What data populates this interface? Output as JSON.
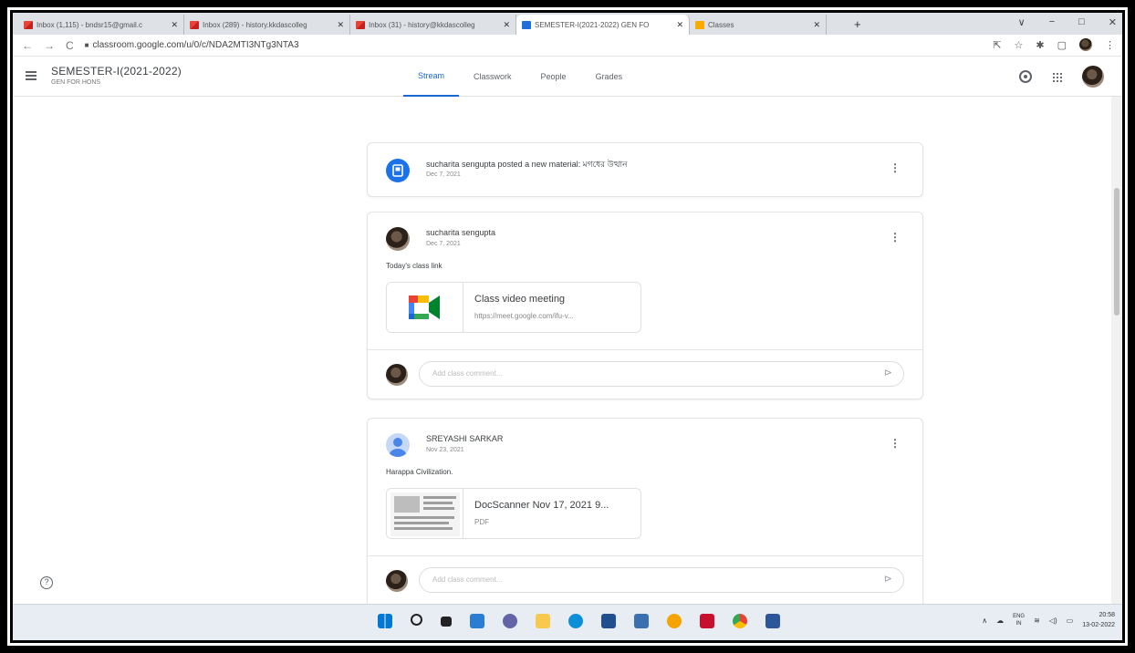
{
  "browser": {
    "tabs": [
      {
        "label": "Inbox (1,115) - bndsr15@gmail.c",
        "favicon": "gmail-icon",
        "active": false
      },
      {
        "label": "Inbox (289) - history.kkdascolleg",
        "favicon": "gmail-icon",
        "active": false
      },
      {
        "label": "Inbox (31) - history@kkdascolleg",
        "favicon": "gmail-icon",
        "active": false
      },
      {
        "label": "SEMESTER-I(2021-2022) GEN FO",
        "favicon": "classroom-icon",
        "active": true
      },
      {
        "label": "Classes",
        "favicon": "classroom-icon",
        "active": false
      }
    ],
    "url": "classroom.google.com/u/0/c/NDA2MTI3NTg3NTA3",
    "window_controls": [
      "∨",
      "−",
      "□",
      "✕"
    ]
  },
  "classroom": {
    "class_title": "SEMESTER-I(2021-2022)",
    "class_section": "GEN FOR HONS",
    "nav_tabs": [
      "Stream",
      "Classwork",
      "People",
      "Grades"
    ],
    "active_tab": "Stream"
  },
  "stream": {
    "material_post": {
      "text": "sucharita sengupta posted a new material: মগধের উত্থান",
      "date": "Dec 7, 2021"
    },
    "post1": {
      "author": "sucharita sengupta",
      "date": "Dec 7, 2021",
      "body": "Today's class link",
      "attachment_title": "Class video meeting",
      "attachment_sub": "https://meet.google.com/ifu-v...",
      "comment_placeholder": "Add class comment..."
    },
    "post2": {
      "author": "SREYASHI SARKAR",
      "date": "Nov 23, 2021",
      "body": "Harappa Civilization.",
      "attachment_title": "DocScanner Nov 17, 2021 9...",
      "attachment_sub": "PDF",
      "comment_placeholder": "Add class comment..."
    }
  },
  "taskbar": {
    "lang_top": "ENG",
    "lang_bottom": "IN",
    "time": "20:58",
    "date": "13-02-2022"
  },
  "colors": {
    "accent": "#1967d2",
    "material_icon": "#1a73e8",
    "tab_strip": "#dee1e6"
  }
}
